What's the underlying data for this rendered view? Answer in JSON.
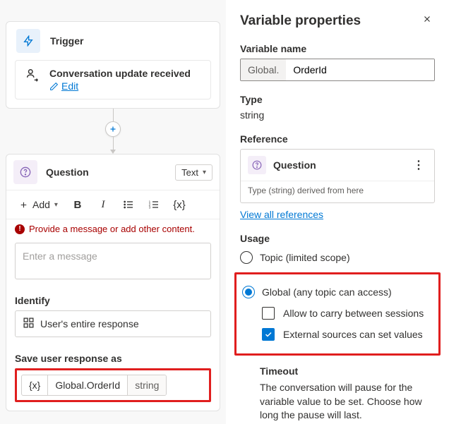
{
  "canvas": {
    "trigger": {
      "title": "Trigger",
      "event_title": "Conversation update received",
      "edit_label": "Edit"
    },
    "question": {
      "title": "Question",
      "output_type_label": "Text",
      "toolbar": {
        "add_label": "Add"
      },
      "error_text": "Provide a message or add other content.",
      "message_placeholder": "Enter a message",
      "identify_label": "Identify",
      "identify_value": "User's entire response",
      "save_label": "Save user response as",
      "variable": {
        "name": "Global.OrderId",
        "type": "string"
      }
    }
  },
  "panel": {
    "title": "Variable properties",
    "var_name_label": "Variable name",
    "var_prefix": "Global.",
    "var_value": "OrderId",
    "type_label": "Type",
    "type_value": "string",
    "reference_label": "Reference",
    "reference_title": "Question",
    "reference_sub": "Type (string) derived from here",
    "view_all": "View all references",
    "usage_label": "Usage",
    "usage_topic": "Topic (limited scope)",
    "usage_global": "Global (any topic can access)",
    "allow_carry": "Allow to carry between sessions",
    "external_set": "External sources can set values",
    "timeout_header": "Timeout",
    "timeout_desc": "The conversation will pause for the variable value to be set. Choose how long the pause will last."
  }
}
